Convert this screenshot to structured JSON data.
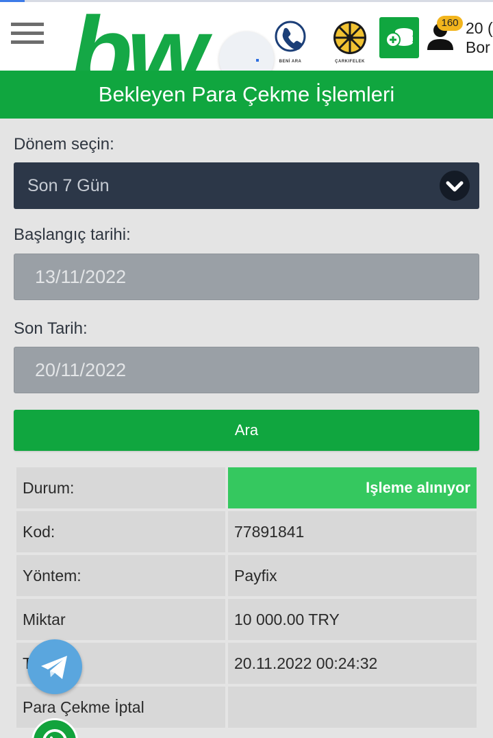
{
  "header": {
    "logo_text": "bw",
    "phone_caption": "BENİ ARA",
    "wheel_caption": "ÇARKIFELEK",
    "notification_count": "160",
    "balance_line1": "20 (",
    "balance_line2": "Bor"
  },
  "page_title": "Bekleyen Para Çekme İşlemleri",
  "form": {
    "period_label": "Dönem seçin:",
    "period_value": "Son 7 Gün",
    "start_label": "Başlangıç tarihi:",
    "start_value": "13/11/2022",
    "end_label": "Son Tarih:",
    "end_value": "20/11/2022",
    "search_button": "Ara"
  },
  "details": {
    "status_label": "Durum:",
    "status_value": "Işleme alınıyor",
    "code_label": "Kod:",
    "code_value": "77891841",
    "method_label": "Yöntem:",
    "method_value": "Payfix",
    "amount_label": "Miktar",
    "amount_value": "10 000.00 TRY",
    "date_label": "T",
    "date_value": "20.11.2022 00:24:32",
    "cancel_label": "Para Çekme İptal",
    "cancel_value": ""
  },
  "colors": {
    "brand_green": "#10a63f",
    "status_green": "#35c85f",
    "select_bg": "#2c3748",
    "telegram": "#5aa6de"
  },
  "icons": [
    "menu-icon",
    "phone-icon",
    "wheel-icon",
    "cash-icon",
    "user-icon",
    "chevron-down-icon",
    "telegram-icon",
    "whatsapp-icon"
  ]
}
